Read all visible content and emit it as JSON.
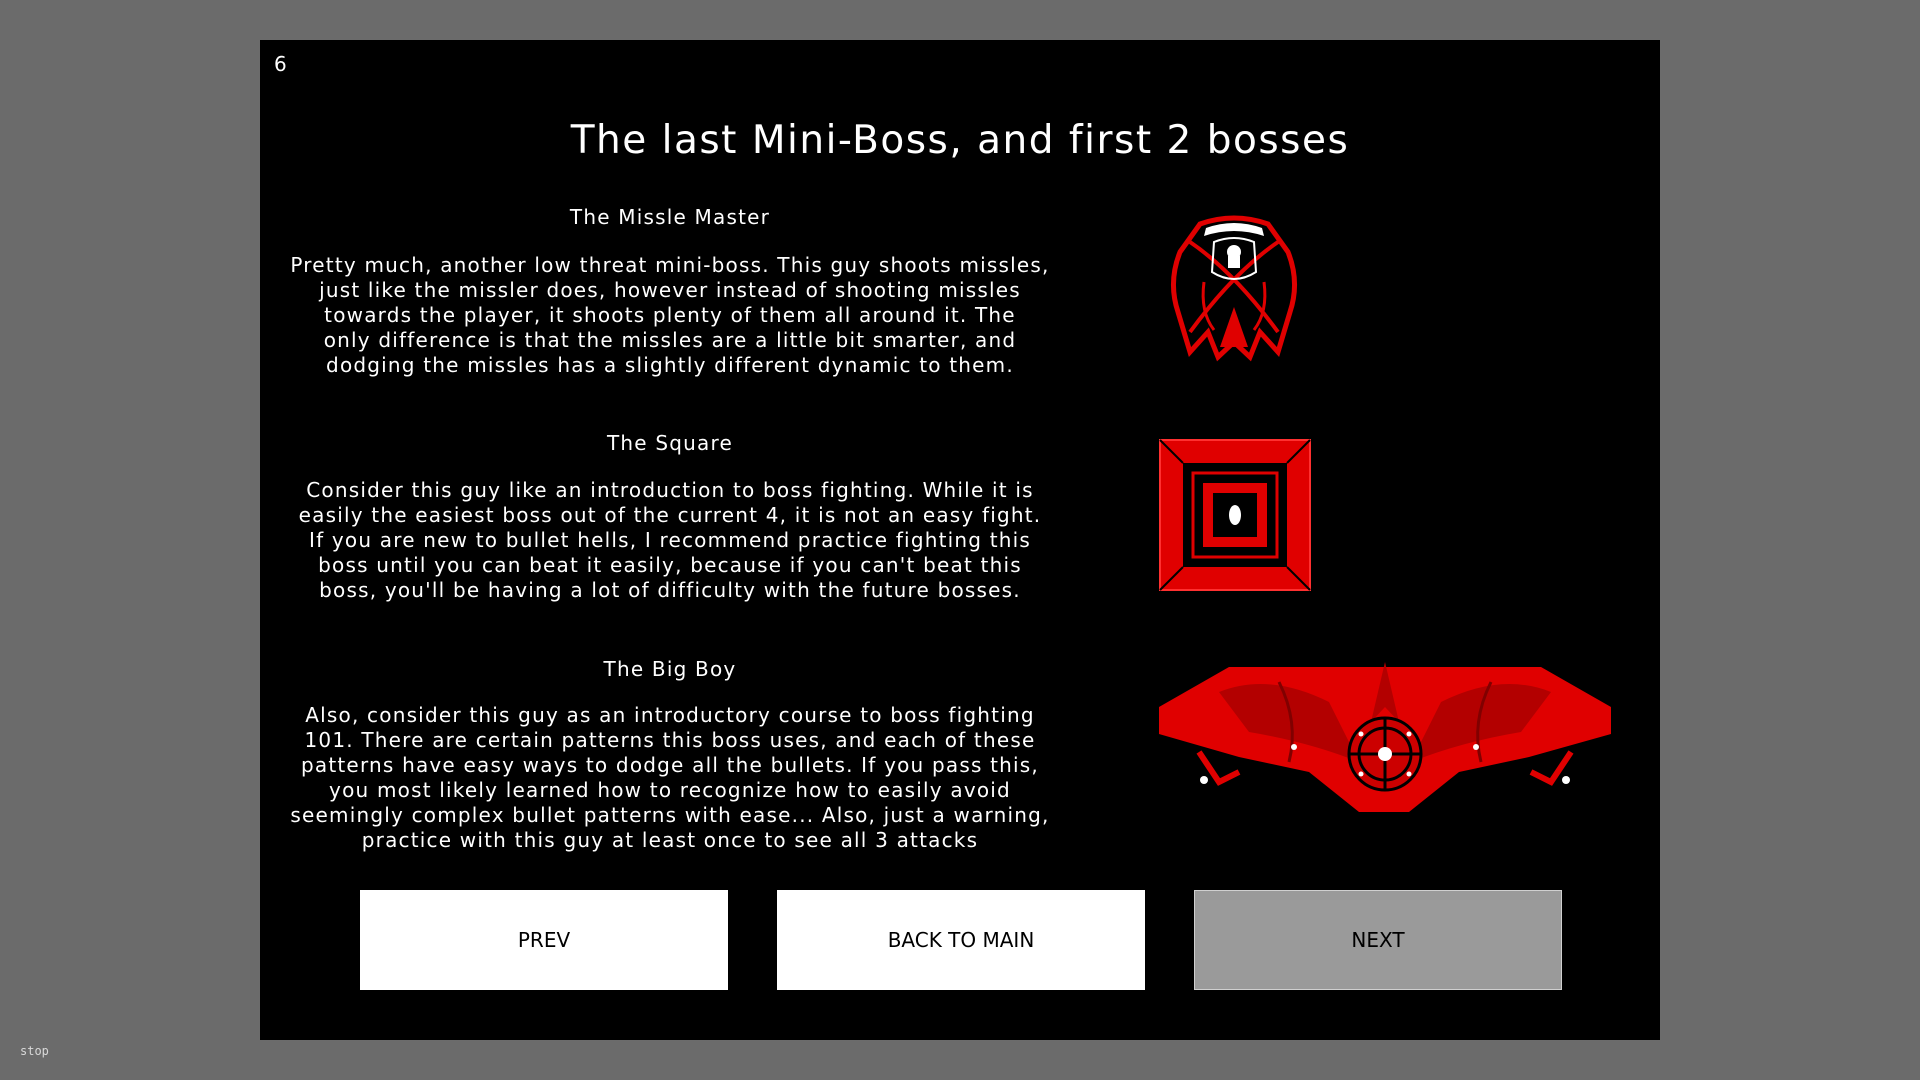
{
  "page_number": "6",
  "title": "The last Mini-Boss, and first 2 bosses",
  "bosses": [
    {
      "name": "The Missle Master",
      "description": "Pretty much, another low threat mini-boss. This guy shoots missles,\njust like the missler does, however instead of shooting missles\ntowards the player, it shoots plenty of them all around it. The\nonly difference is that the missles are a little bit smarter, and\ndodging the missles has a slightly different dynamic to them.",
      "sprite_icon": "missle-master-sprite"
    },
    {
      "name": "The Square",
      "description": "Consider this guy like an introduction to boss fighting. While it is\neasily the easiest boss out of the current 4, it is not an easy fight.\nIf you are new to bullet hells, I recommend practice fighting this\nboss until you can beat it easily, because if you can't beat this\nboss, you'll be having a lot of difficulty with the future bosses.",
      "sprite_icon": "square-boss-sprite"
    },
    {
      "name": "The Big Boy",
      "description": "Also, consider this guy as an introductory course to boss fighting\n101. There are certain patterns this boss uses, and each of these\npatterns have easy ways to dodge all the bullets. If you pass this,\nyou most likely learned how to recognize how to easily avoid\nseemingly complex bullet patterns with ease... Also, just a warning,\npractice with this guy at least once to see all 3 attacks",
      "sprite_icon": "big-boy-sprite"
    }
  ],
  "buttons": {
    "prev": "PREV",
    "back": "BACK TO MAIN",
    "next": "NEXT"
  },
  "status": "stop",
  "colors": {
    "background": "#6b6b6b",
    "stage": "#000000",
    "boss_red": "#e00000",
    "button_white": "#ffffff",
    "button_grey": "#9a9a9a"
  }
}
